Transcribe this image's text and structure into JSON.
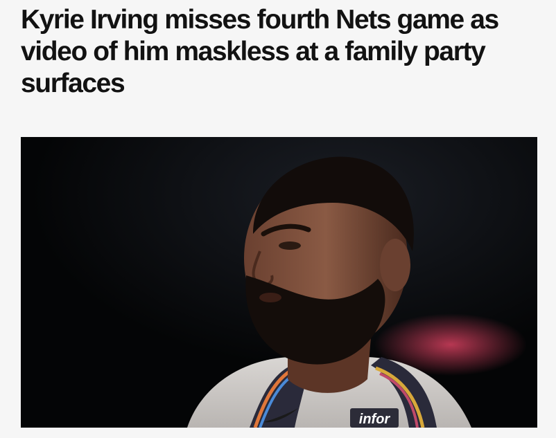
{
  "article": {
    "headline": "Kyrie Irving misses fourth Nets game as video of him maskless at a family party surfaces",
    "hero_image": {
      "description": "player-portrait-photo",
      "jersey_text": "infor"
    }
  },
  "colors": {
    "page_background": "#f6f6f6",
    "headline_text": "#121212",
    "photo_background": "#050607"
  }
}
